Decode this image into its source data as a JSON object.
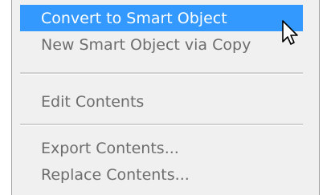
{
  "menu": {
    "items": [
      {
        "label": "Convert to Smart Object"
      },
      {
        "label": "New Smart Object via Copy"
      },
      {
        "label": "Edit Contents"
      },
      {
        "label": "Export Contents..."
      },
      {
        "label": "Replace Contents..."
      }
    ]
  },
  "icons": {
    "cursor": "arrow-pointer-icon"
  },
  "colors": {
    "highlight": "#3399ff",
    "menu_bg": "#f0f0f0",
    "text": "#6d6d6d"
  }
}
